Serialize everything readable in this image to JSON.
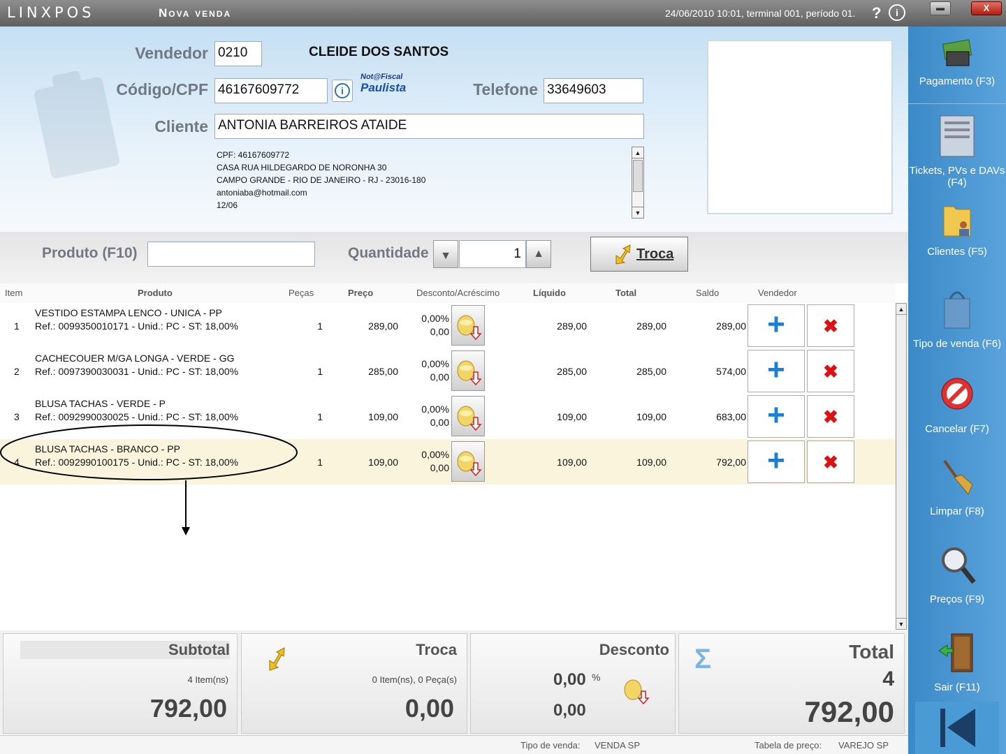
{
  "titlebar": {
    "logo": "LINXPOS",
    "title": "Nova venda",
    "status": "24/06/2010 10:01, terminal 001, período 01.",
    "help": "?",
    "info": "i",
    "minimize": "▬",
    "close": "X"
  },
  "form": {
    "vendedor_label": "Vendedor",
    "vendedor_code": "0210",
    "vendedor_name": "CLEIDE DOS SANTOS",
    "cpf_label": "Código/CPF",
    "cpf_value": "46167609772",
    "nfp_top": "Not@Fiscal",
    "nfp_bottom": "Paulista",
    "telefone_label": "Telefone",
    "telefone_value": "33649603",
    "cliente_label": "Cliente",
    "cliente_value": "ANTONIA BARREIROS ATAIDE",
    "cliente_info": [
      "CPF: 46167609772",
      "CASA RUA HILDEGARDO DE NORONHA 30",
      "CAMPO GRANDE - RIO DE JANEIRO - RJ - 23016-180",
      "antoniaba@hotmail.com",
      "12/06"
    ]
  },
  "productbar": {
    "produto_label": "Produto (F10)",
    "produto_value": "",
    "quantidade_label": "Quantidade",
    "quantidade_value": "1",
    "troca_label": "Troca"
  },
  "table": {
    "headers": {
      "item": "Item",
      "produto": "Produto",
      "pecas": "Peças",
      "preco": "Preço",
      "desconto": "Desconto/Acréscimo",
      "liquido": "Líquido",
      "total": "Total",
      "saldo": "Saldo",
      "vendedor": "Vendedor"
    },
    "rows": [
      {
        "item": "1",
        "name": "VESTIDO ESTAMPA LENCO - UNICA - PP",
        "ref": "Ref.: 0099350010171 - Unid.: PC - ST: 18,00%",
        "pecas": "1",
        "preco": "289,00",
        "desc_pct": "0,00%",
        "desc_val": "0,00",
        "liquido": "289,00",
        "total": "289,00",
        "saldo": "289,00"
      },
      {
        "item": "2",
        "name": "CACHECOUER M/GA LONGA - VERDE - GG",
        "ref": "Ref.: 0097390030031 - Unid.: PC - ST: 18,00%",
        "pecas": "1",
        "preco": "285,00",
        "desc_pct": "0,00%",
        "desc_val": "0,00",
        "liquido": "285,00",
        "total": "285,00",
        "saldo": "574,00"
      },
      {
        "item": "3",
        "name": "BLUSA TACHAS - VERDE - P",
        "ref": "Ref.: 0092990030025 - Unid.: PC - ST: 18,00%",
        "pecas": "1",
        "preco": "109,00",
        "desc_pct": "0,00%",
        "desc_val": "0,00",
        "liquido": "109,00",
        "total": "109,00",
        "saldo": "683,00"
      },
      {
        "item": "4",
        "name": "BLUSA TACHAS - BRANCO - PP",
        "ref": "Ref.: 0092990100175 - Unid.: PC - ST: 18,00%",
        "pecas": "1",
        "preco": "109,00",
        "desc_pct": "0,00%",
        "desc_val": "0,00",
        "liquido": "109,00",
        "total": "109,00",
        "saldo": "792,00"
      }
    ]
  },
  "totals": {
    "subtotal_label": "Subtotal",
    "subtotal_items": "4 Item(ns)",
    "subtotal_value": "792,00",
    "troca_label": "Troca",
    "troca_items": "0 Item(ns), 0 Peça(s)",
    "troca_value": "0,00",
    "desconto_label": "Desconto",
    "desconto_pct": "0,00",
    "desconto_pct_unit": "%",
    "desconto_value": "0,00",
    "total_label": "Total",
    "total_count": "4",
    "total_value": "792,00"
  },
  "statusbar": {
    "tipo_label": "Tipo de venda:",
    "tipo_value": "VENDA SP",
    "tabela_label": "Tabela de preço:",
    "tabela_value": "VAREJO SP"
  },
  "sidebar": [
    {
      "label": "Pagamento (F3)",
      "icon": "money-icon"
    },
    {
      "label": "Tickets, PVs e DAVs (F4)",
      "icon": "tickets-icon"
    },
    {
      "label": "Clientes (F5)",
      "icon": "clients-folder-icon"
    },
    {
      "label": "Tipo de venda (F6)",
      "icon": "shopping-bag-icon"
    },
    {
      "label": "Cancelar (F7)",
      "icon": "cancel-icon"
    },
    {
      "label": "Limpar (F8)",
      "icon": "broom-icon"
    },
    {
      "label": "Preços (F9)",
      "icon": "magnifier-icon"
    },
    {
      "label": "Sair (F11)",
      "icon": "exit-door-icon"
    }
  ],
  "colors": {
    "sidebar": "#3b89c7",
    "highlight_row": "#fbf4dc",
    "plus": "#1a7fd8",
    "delete": "#d11111"
  }
}
